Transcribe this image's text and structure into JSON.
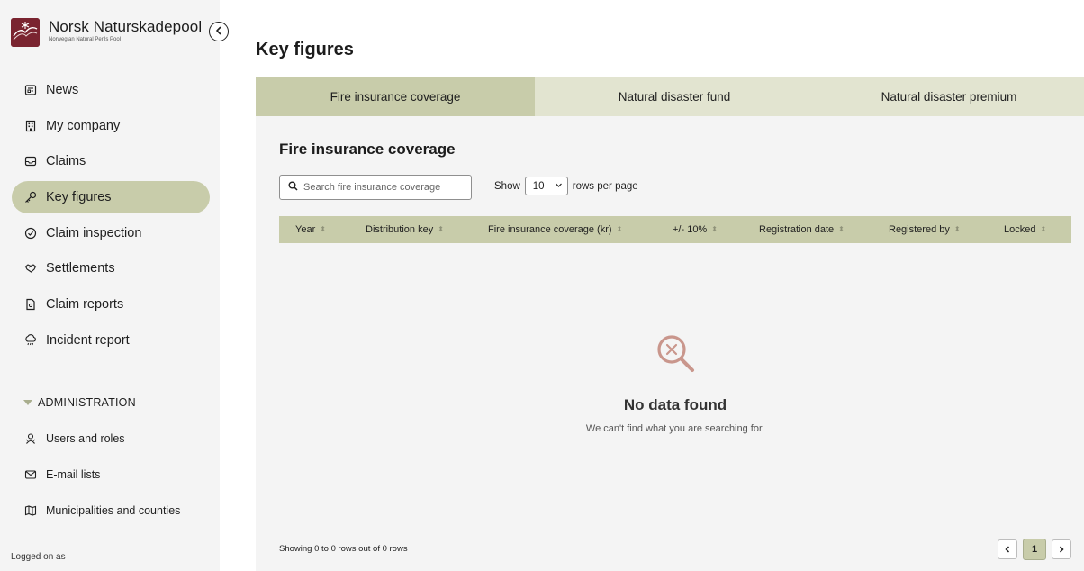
{
  "brand": {
    "name": "Norsk Naturskadepool",
    "subtitle": "Norwegian Natural Perils Pool"
  },
  "sidebar": {
    "items": [
      {
        "label": "News",
        "icon": "newspaper-icon"
      },
      {
        "label": "My company",
        "icon": "building-icon"
      },
      {
        "label": "Claims",
        "icon": "inbox-icon"
      },
      {
        "label": "Key figures",
        "icon": "key-icon",
        "active": true
      },
      {
        "label": "Claim inspection",
        "icon": "check-circle-icon"
      },
      {
        "label": "Settlements",
        "icon": "handshake-icon"
      },
      {
        "label": "Claim reports",
        "icon": "document-icon"
      },
      {
        "label": "Incident report",
        "icon": "storm-icon"
      }
    ],
    "admin_label": "ADMINISTRATION",
    "admin_items": [
      {
        "label": "Users and roles",
        "icon": "users-icon"
      },
      {
        "label": "E-mail lists",
        "icon": "mail-icon"
      },
      {
        "label": "Municipalities and counties",
        "icon": "map-icon"
      }
    ],
    "logged_on": "Logged on as"
  },
  "page": {
    "title": "Key figures",
    "tabs": [
      "Fire insurance coverage",
      "Natural disaster fund",
      "Natural disaster premium"
    ],
    "section_title": "Fire insurance coverage",
    "search_placeholder": "Search fire insurance coverage",
    "show_label": "Show",
    "rows_value": "10",
    "rows_suffix": "rows per page",
    "columns": [
      "Year",
      "Distribution key",
      "Fire insurance coverage (kr)",
      "+/- 10%",
      "Registration date",
      "Registered by",
      "Locked"
    ],
    "empty_title": "No data found",
    "empty_subtitle": "We can't find what you are searching for.",
    "footer": "Showing 0 to 0 rows out of 0 rows",
    "current_page": "1"
  },
  "colors": {
    "accent": "#c8ccaa",
    "tab_bg": "#e2e4d0",
    "brand": "#7a2430",
    "empty_icon": "#c9968c"
  }
}
